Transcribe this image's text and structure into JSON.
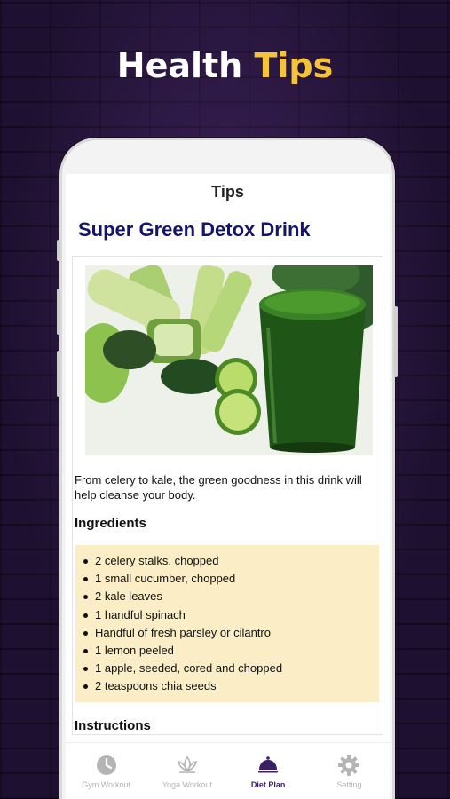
{
  "promo": {
    "title_main": "Health",
    "title_accent": "Tips",
    "accent_color": "#f6c338"
  },
  "screen": {
    "header_title": "Tips",
    "article_title": "Super Green Detox Drink",
    "image_icon": "green-smoothie-photo",
    "intro": "From celery to kale, the green goodness in this drink will help cleanse your body.",
    "ingredients_heading": "Ingredients",
    "ingredients": [
      "2 celery stalks, chopped",
      "1 small cucumber, chopped",
      "2 kale leaves",
      "1 handful spinach",
      "Handful of fresh parsley or cilantro",
      "1 lemon peeled",
      "1 apple, seeded, cored and chopped",
      "2 teaspoons chia seeds"
    ],
    "instructions_heading": "Instructions"
  },
  "nav": {
    "items": [
      {
        "label": "Gym Workout",
        "icon": "clock-icon",
        "active": false
      },
      {
        "label": "Yoga Workout",
        "icon": "lotus-icon",
        "active": false
      },
      {
        "label": "Diet Plan",
        "icon": "food-cloche-icon",
        "active": true
      },
      {
        "label": "Setting",
        "icon": "gear-icon",
        "active": false
      }
    ],
    "active_color": "#3a1f63",
    "inactive_color": "#b4b4b4"
  }
}
